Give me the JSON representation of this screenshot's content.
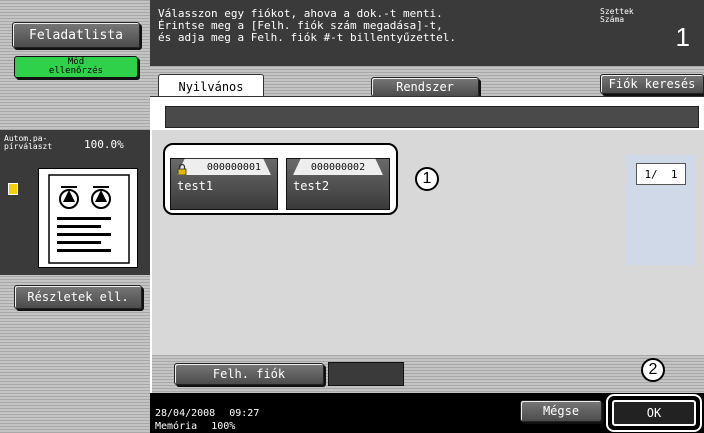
{
  "left": {
    "task_list_label": "Feladatlista",
    "check_mode_label": "Mód\nellenőrzés",
    "auto_paper_label": "Autom.pa-\npírválaszt",
    "zoom": "100.0%",
    "details_label": "Részletek ell."
  },
  "header": {
    "message_lines": [
      "Válasszon egy fiókot, ahova a dok.-t menti.",
      "Érintse meg a [Felh. fiók szám megadása]-t,",
      "és adja meg a Felh. fiók #-t billentyűzettel."
    ],
    "sets_label": "Szettek\nSzáma",
    "sets_value": "1"
  },
  "tabs": {
    "public_label": "Nyilvános",
    "system_label": "Rendszer",
    "search_label": "Fiók keresés"
  },
  "accounts": [
    {
      "number": "000000001",
      "name": "test1",
      "locked": true
    },
    {
      "number": "000000002",
      "name": "test2",
      "locked": false
    }
  ],
  "pagination": "1/  1",
  "user_box_label": "Felh. fiók",
  "footer": {
    "date": "28/04/2008",
    "time": "09:27",
    "memory_label": "Memória",
    "memory_value": "100%",
    "cancel_label": "Mégse",
    "ok_label": "OK"
  },
  "callouts": [
    "1",
    "2"
  ]
}
